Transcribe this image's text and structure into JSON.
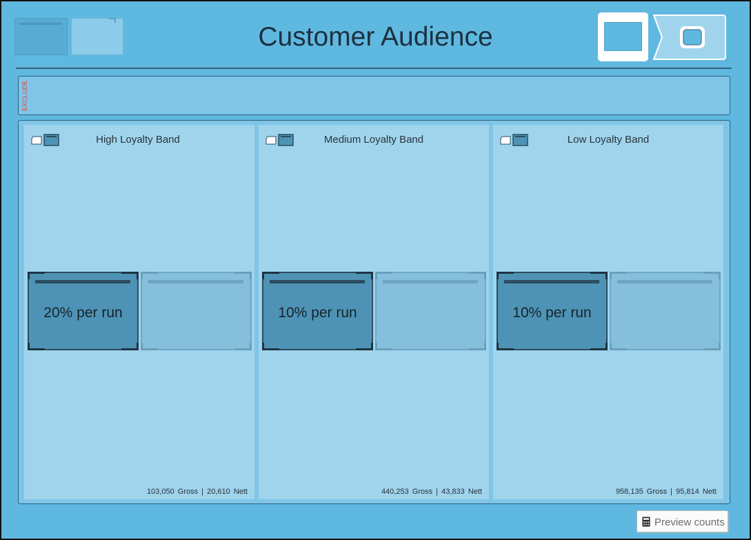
{
  "header": {
    "title": "Customer Audience"
  },
  "exclude": {
    "label": "EXCLUDE"
  },
  "bands": [
    {
      "title": "High Loyalty Band",
      "rate": "20% per run",
      "gross": "103,050",
      "gross_label": "Gross",
      "sep": "|",
      "nett": "20,610",
      "nett_label": "Nett"
    },
    {
      "title": "Medium Loyalty Band",
      "rate": "10% per run",
      "gross": "440,253",
      "gross_label": "Gross",
      "sep": "|",
      "nett": "43,833",
      "nett_label": "Nett"
    },
    {
      "title": "Low Loyalty Band",
      "rate": "10% per run",
      "gross": "958,135",
      "gross_label": "Gross",
      "sep": "|",
      "nett": "95,814",
      "nett_label": "Nett"
    }
  ],
  "footer": {
    "preview_label": "Preview counts",
    "preview_icon": "calculator-icon"
  },
  "colors": {
    "background": "#5fb8e0",
    "band": "#a0d4ec",
    "active_cell": "#4e93b5",
    "exclude_label": "#e0453a"
  }
}
